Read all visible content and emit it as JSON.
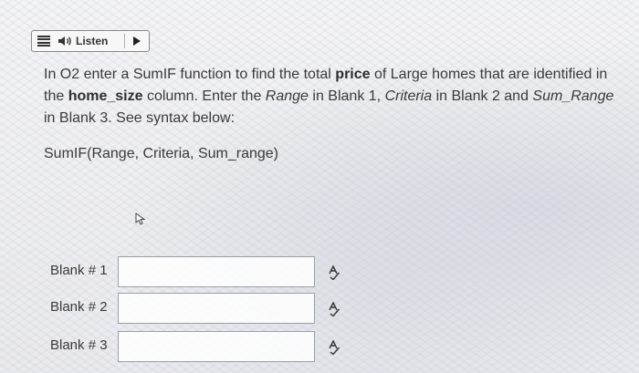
{
  "listen_bar": {
    "label": "Listen",
    "icons": [
      "menu-icon",
      "speaker-icon",
      "play-icon"
    ]
  },
  "question": {
    "p1": "In O2 enter a SumIF function to find the total ",
    "price": "price",
    "p2": " of Large homes that are identified in the ",
    "home_size": "home_size",
    "p3": " column.  Enter the ",
    "range": "Range",
    "p4": " in Blank 1, ",
    "criteria": "Criteria",
    "p5": " in Blank 2 and ",
    "sum_range": "Sum_Range",
    "p6": " in Blank 3.  See syntax below:"
  },
  "syntax": "SumIF(Range, Criteria, Sum_range)",
  "blanks": [
    {
      "label": "Blank # 1",
      "value": ""
    },
    {
      "label": "Blank # 2",
      "value": ""
    },
    {
      "label": "Blank # 3",
      "value": ""
    }
  ],
  "colors": {
    "text": "#3a3a3a",
    "input_border": "#9aa0a6"
  }
}
